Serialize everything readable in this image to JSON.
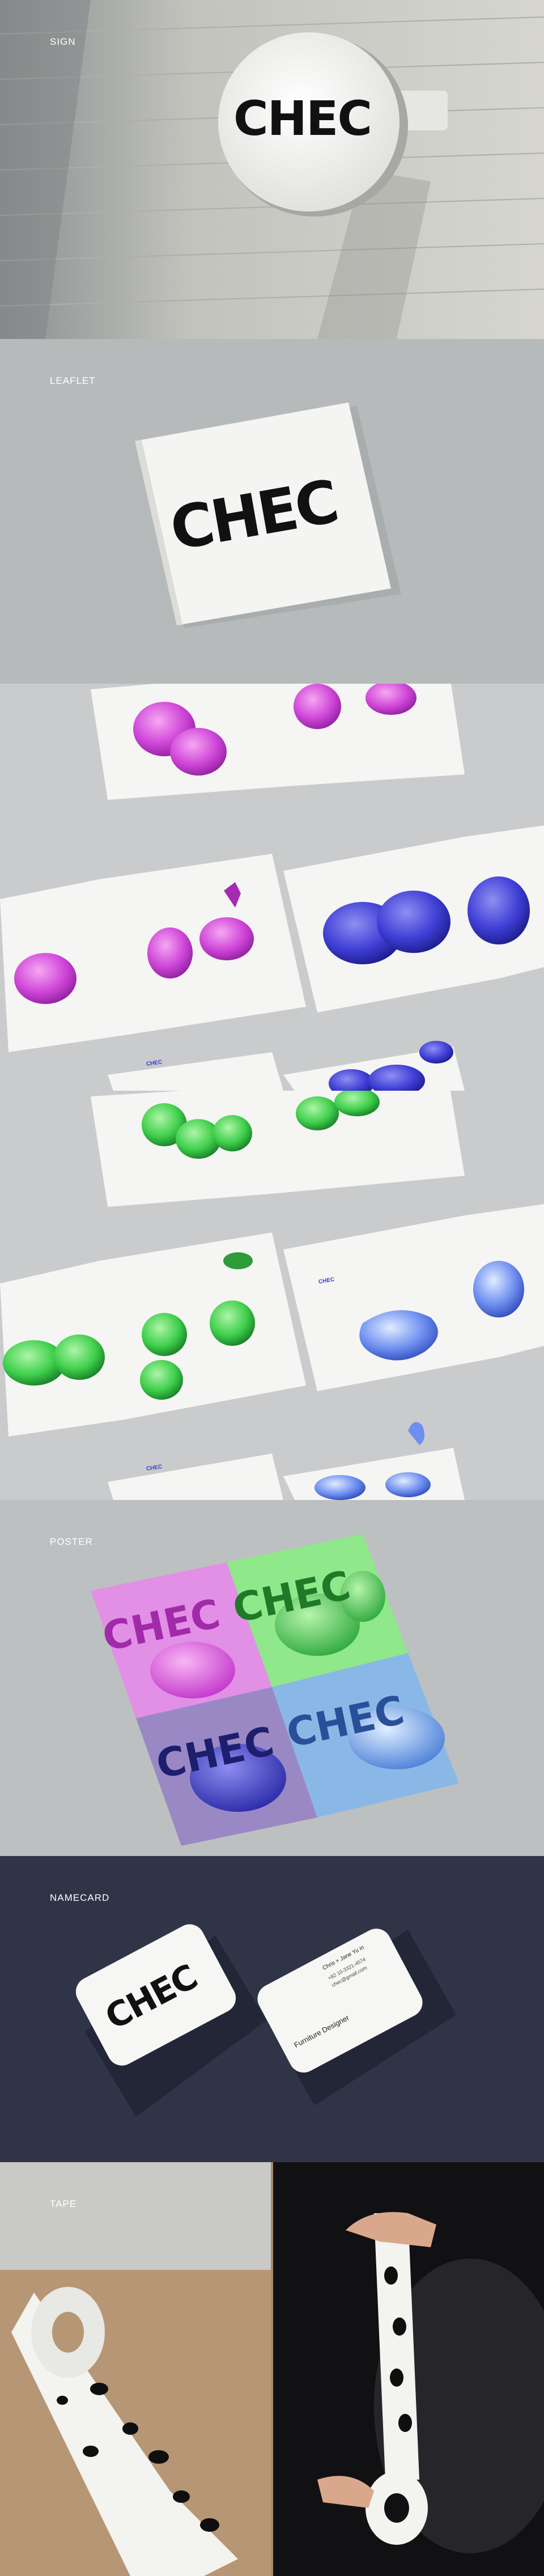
{
  "sections": {
    "sign": {
      "label": "SIGN",
      "logo": "CHEC"
    },
    "leaflet": {
      "label": "LEAFLET",
      "logo": "CHEC"
    },
    "spreads_pink": {
      "brand": "CHEC"
    },
    "spreads_green": {
      "brand": "CHEC"
    },
    "poster": {
      "label": "POSTER",
      "logo": "CHEC"
    },
    "namecard": {
      "label": "NAMECARD",
      "logo": "CHEC",
      "name": "Chris × Jane Yu in",
      "role": "Furniture Designer",
      "phone": "+82 10-3321-4574",
      "email": "chec@gmail.com"
    },
    "tape": {
      "label": "TAPE"
    }
  },
  "colors": {
    "sign_bg": "#cfd0cb",
    "leaflet_bg": "#b9bcbd",
    "spread_bg": "#cbcdce",
    "poster_bg": "#bfc3c4",
    "namecard_bg": "#2f3547",
    "tape_bg": "#a98a69",
    "pink": "#d24bd9",
    "green": "#3fd04d",
    "blue": "#3b3bd6"
  }
}
